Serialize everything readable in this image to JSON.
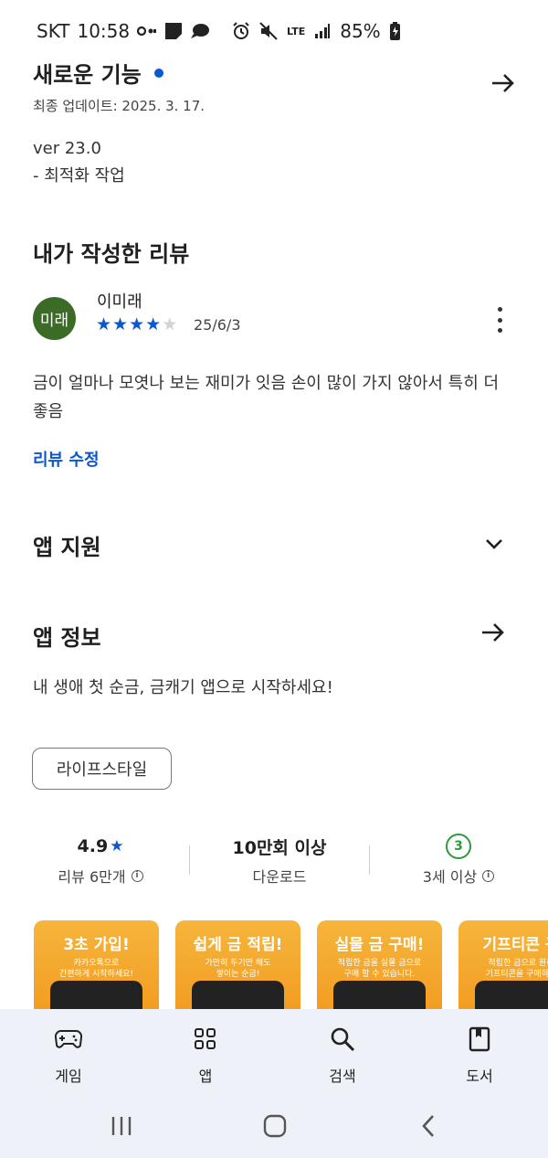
{
  "status_bar": {
    "carrier": "SKT",
    "time": "10:58",
    "network": "LTE",
    "battery": "85%"
  },
  "whats_new": {
    "title": "새로운 기능",
    "updated": "최종 업데이트: 2025. 3. 17.",
    "version": "ver 23.0",
    "notes": "- 최적화 작업"
  },
  "my_review": {
    "title": "내가 작성한 리뷰",
    "avatar_text": "미래",
    "reviewer": "이미래",
    "rating": 4,
    "date": "25/6/3",
    "text": "금이 얼마나 모엿나 보는 재미가 잇음 손이 많이 가지 않아서 특히 더 좋음",
    "edit_label": "리뷰 수정"
  },
  "app_support": {
    "title": "앱 지원"
  },
  "app_info": {
    "title": "앱 정보",
    "description": "내 생애 첫 순금, 금캐기 앱으로 시작하세요!",
    "category": "라이프스타일"
  },
  "stats": {
    "rating_value": "4.9",
    "reviews_label": "리뷰 6만개",
    "downloads_value": "10만회 이상",
    "downloads_label": "다운로드",
    "age_value": "3",
    "age_label": "3세 이상"
  },
  "screenshots": [
    {
      "title": "3초 가입!",
      "sub1": "카카오톡으로",
      "sub2": "간편하게 시작하세요!"
    },
    {
      "title": "쉽게 금 적립!",
      "sub1": "가만히 두기만 해도",
      "sub2": "쌓이는 순금!"
    },
    {
      "title": "실물 금 구매!",
      "sub1": "적립한 금을 실물 금으로",
      "sub2": "구매 할 수 있습니다."
    },
    {
      "title": "기프티콘 구",
      "sub1": "적립한 금으로 원하",
      "sub2": "기프티콘을 구매하세"
    }
  ],
  "bottom_nav": [
    {
      "label": "게임",
      "icon": "gamepad-icon"
    },
    {
      "label": "앱",
      "icon": "apps-grid-icon"
    },
    {
      "label": "검색",
      "icon": "search-icon"
    },
    {
      "label": "도서",
      "icon": "book-icon"
    }
  ]
}
